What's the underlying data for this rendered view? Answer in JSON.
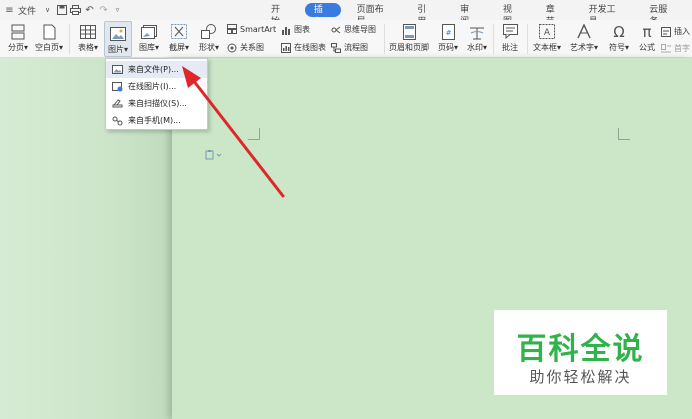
{
  "topbar": {
    "menu_label": "文件",
    "tabs": [
      "开始",
      "插入",
      "页面布局",
      "引用",
      "审阅",
      "视图",
      "章节",
      "开发工具",
      "云服务"
    ],
    "active_tab": "插入"
  },
  "ribbon": {
    "fenye": "分页",
    "kongbaiye": "空白页",
    "biaoge": "表格",
    "tupian": "图片",
    "tuku": "图库",
    "jieping": "截屏",
    "xingzhuang": "形状",
    "smartart": "SmartArt",
    "tubiao": "图表",
    "siweidaotu": "思维导图",
    "guanxitu": "关系图",
    "zaixiantubiao": "在线图表",
    "liuchengtu": "流程图",
    "yemeiheyejiao": "页眉和页脚",
    "yema": "页码",
    "shuiyin": "水印",
    "pizhu": "批注",
    "wenbenkuang": "文本框",
    "yishuzi": "艺术字",
    "fuhao": "符号",
    "gongshi": "公式",
    "charu": "插入",
    "shouzi": "首字"
  },
  "picture_menu": {
    "items": [
      "来自文件(P)...",
      "在线图片(I)...",
      "来自扫描仪(S)...",
      "来自手机(M)..."
    ]
  },
  "watermark": {
    "title": "百科全说",
    "subtitle": "助你轻松解决"
  },
  "colors": {
    "accent": "#3a7be0",
    "arrow": "#e0262b",
    "watermark_green": "#2fb34a",
    "page_bg": "#cbe7c8"
  }
}
